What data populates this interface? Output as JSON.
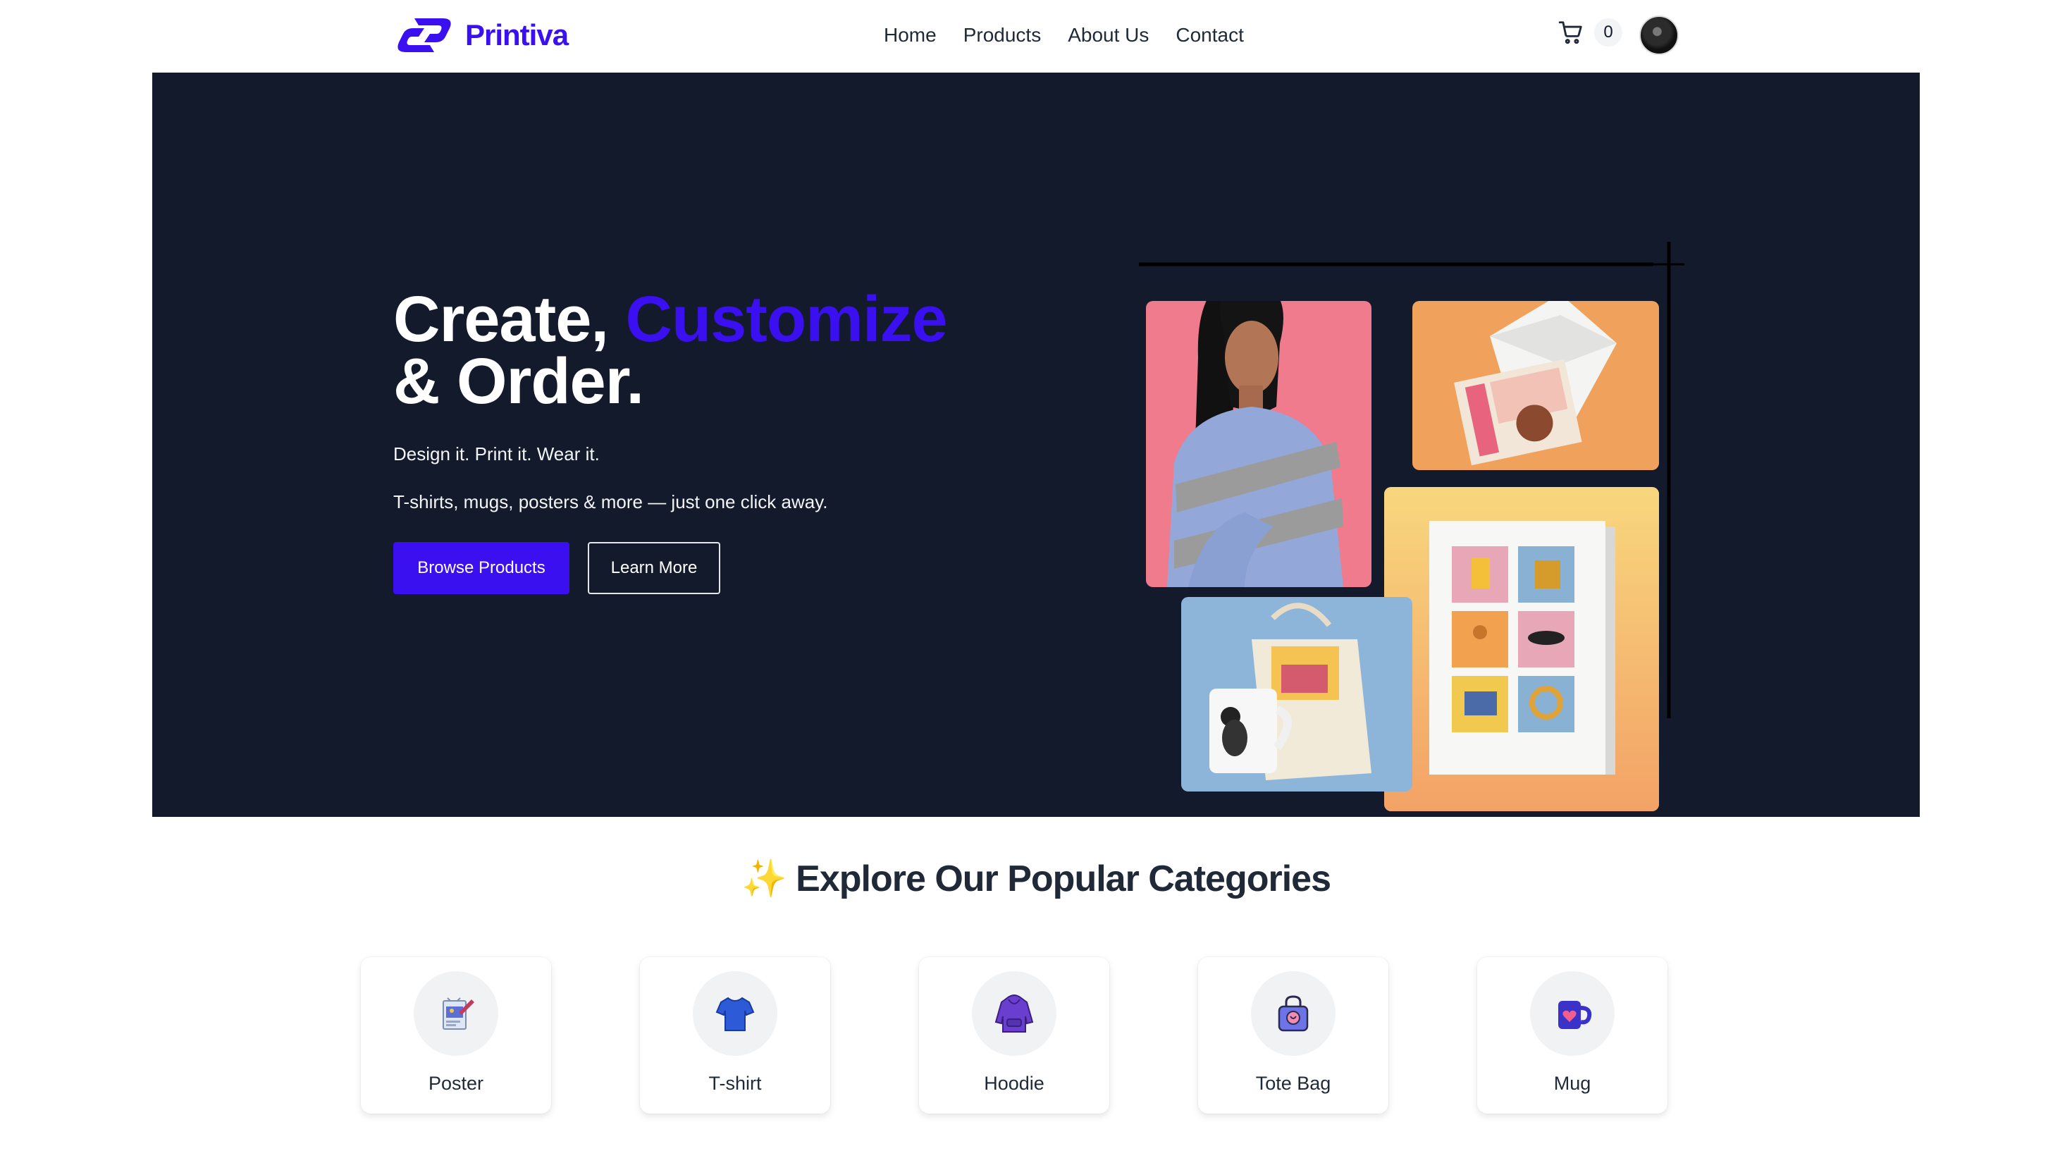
{
  "brand": {
    "name": "Printiva",
    "color": "#3a0ff0"
  },
  "nav": {
    "links": [
      "Home",
      "Products",
      "About Us",
      "Contact"
    ],
    "cart_count": "0"
  },
  "hero": {
    "title_part1": "Create, ",
    "title_accent": "Customize",
    "title_part2": "& Order.",
    "tagline": "Design it. Print it. Wear it.",
    "description": "T-shirts, mugs, posters & more — just one click away.",
    "primary_button": "Browse Products",
    "secondary_button": "Learn More",
    "background": "#131a2c"
  },
  "categories": {
    "title": "Explore Our Popular Categories",
    "emoji": "✨",
    "items": [
      {
        "label": "Poster",
        "icon": "poster-icon"
      },
      {
        "label": "T-shirt",
        "icon": "tshirt-icon"
      },
      {
        "label": "Hoodie",
        "icon": "hoodie-icon"
      },
      {
        "label": "Tote Bag",
        "icon": "tote-bag-icon"
      },
      {
        "label": "Mug",
        "icon": "mug-icon"
      }
    ]
  }
}
